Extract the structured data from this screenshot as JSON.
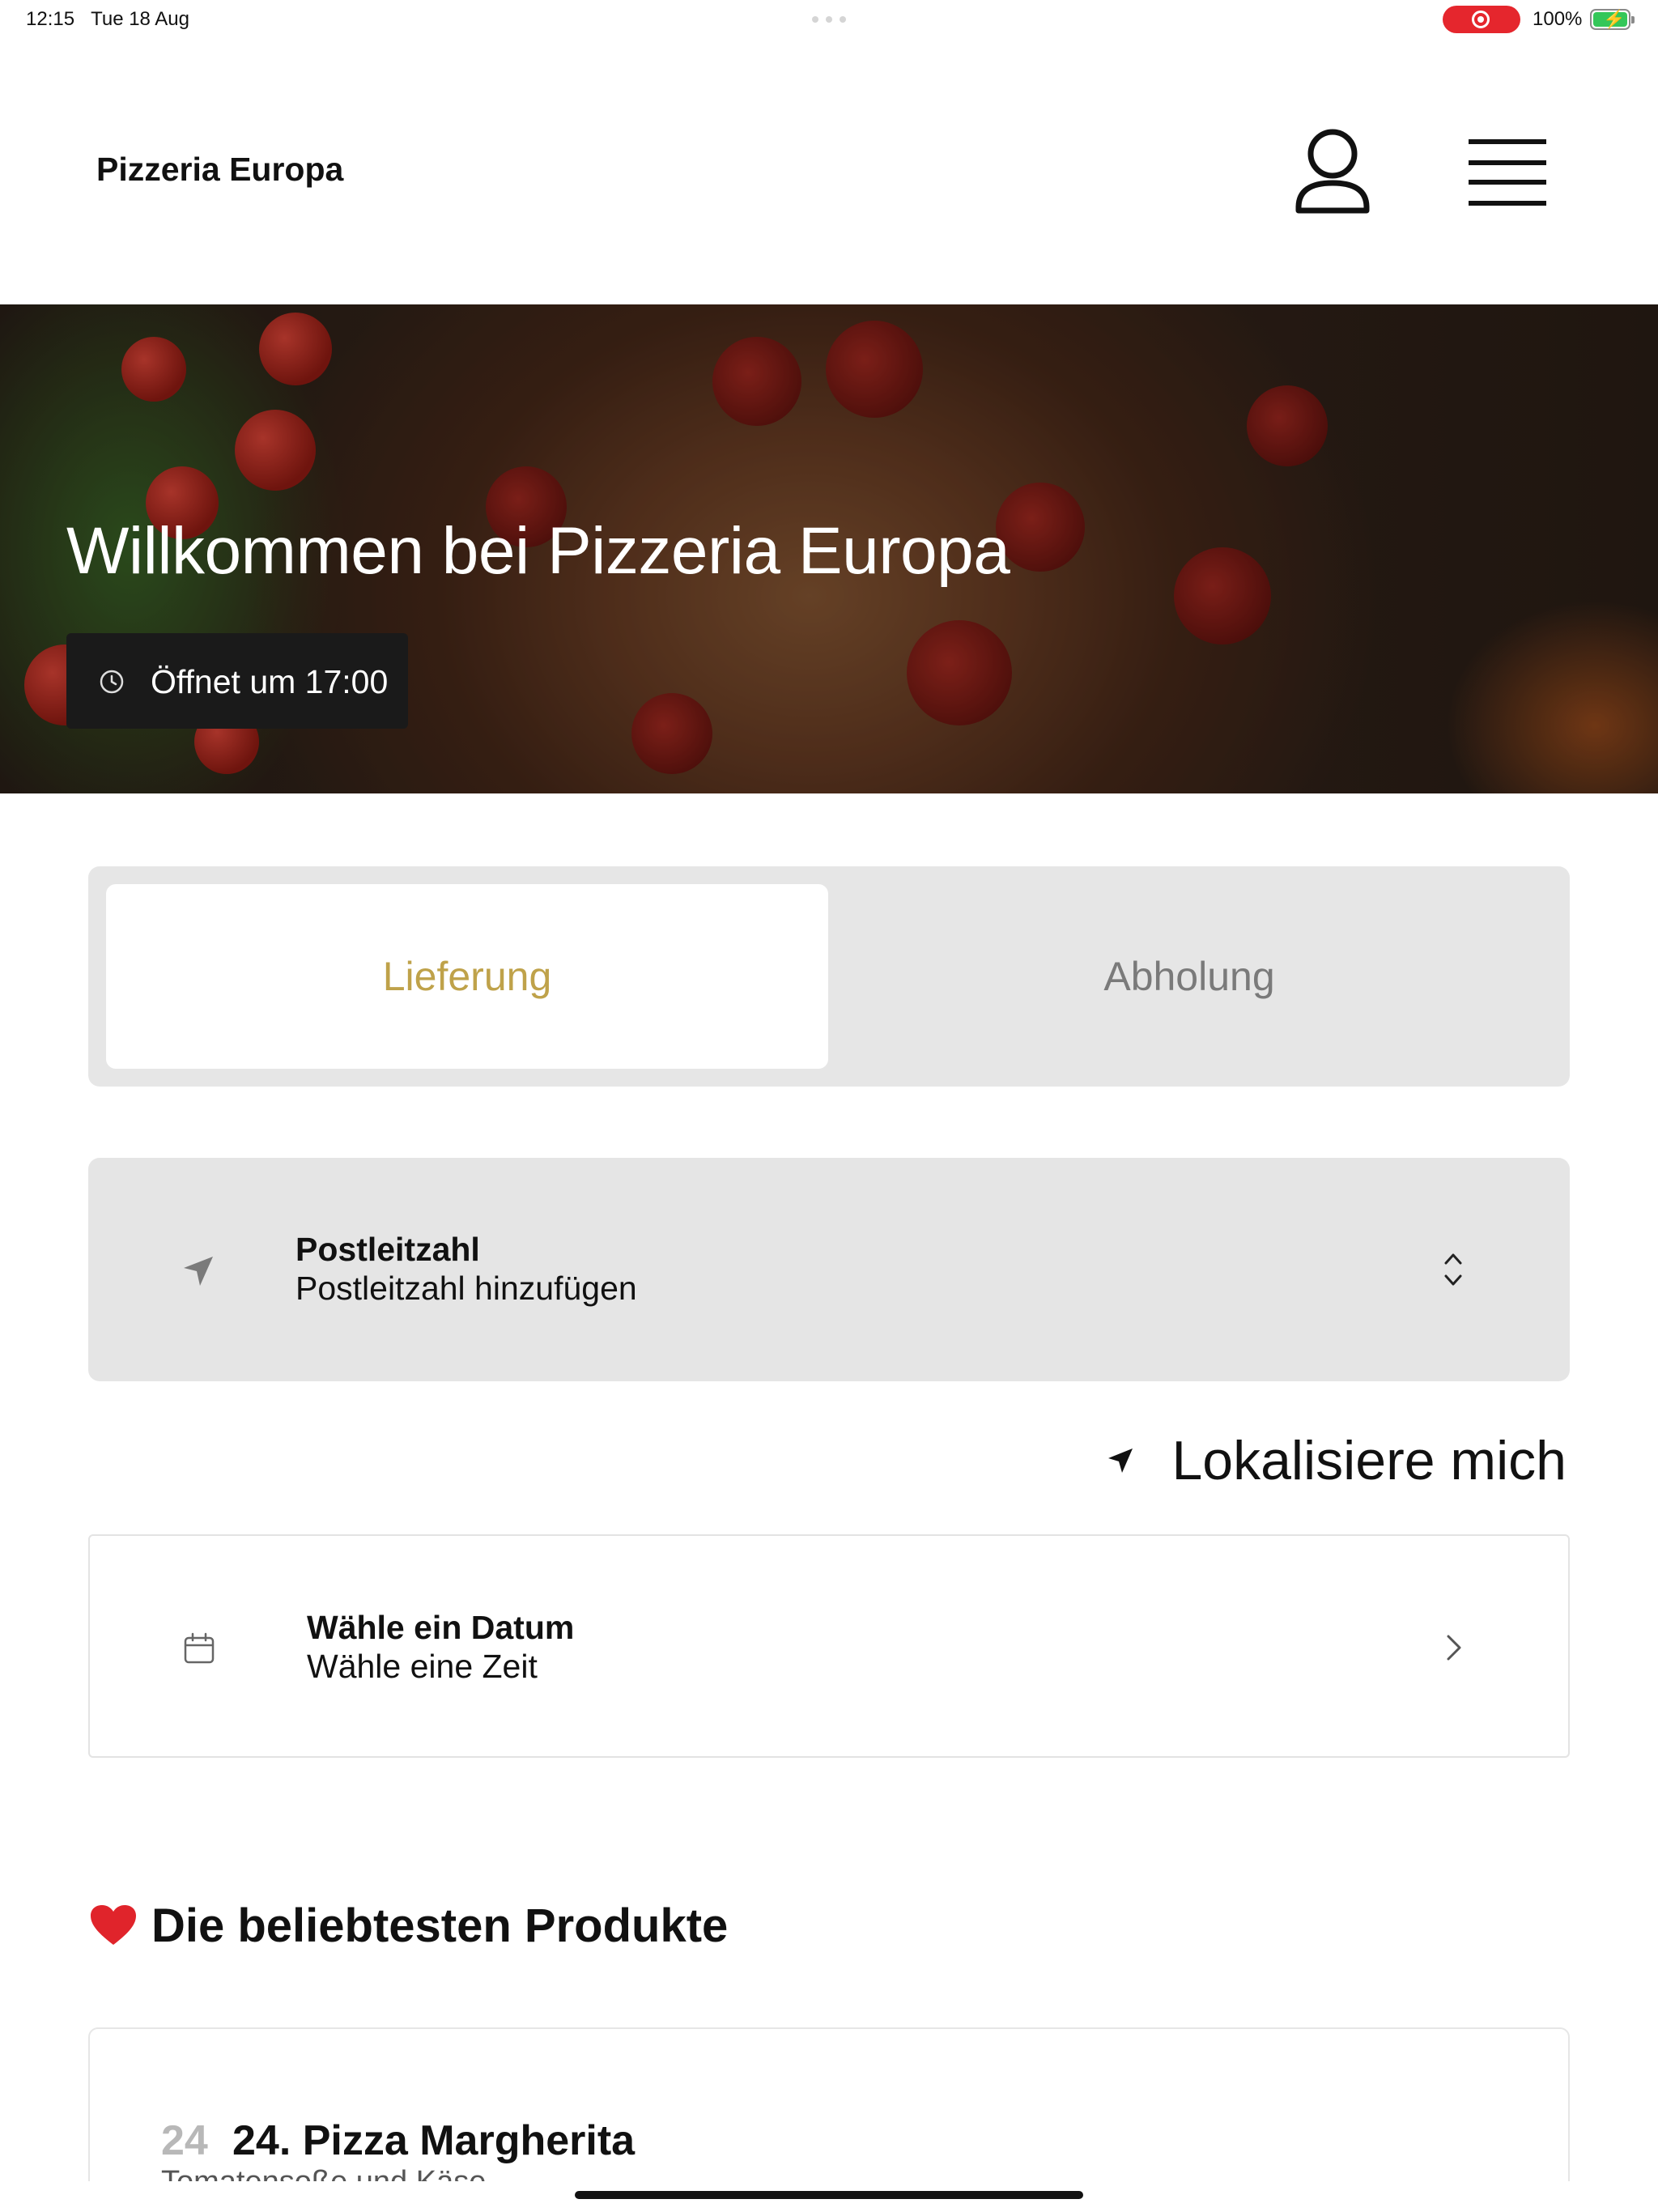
{
  "status_bar": {
    "time": "12:15",
    "date": "Tue 18 Aug",
    "battery": "100%",
    "recording_color": "#e5262d",
    "battery_color": "#34c759"
  },
  "header": {
    "brand": "Pizzeria Europa",
    "icons": [
      "user-icon",
      "menu-icon"
    ]
  },
  "hero": {
    "title": "Willkommen bei Pizzeria Europa",
    "hours": "Öffnet um 17:00"
  },
  "order_mode": {
    "options": [
      "Lieferung",
      "Abholung"
    ],
    "selected": "Lieferung",
    "accent_color": "#bfa24a"
  },
  "postal": {
    "label": "Postleitzahl",
    "value": "Postleitzahl hinzufügen"
  },
  "locate": {
    "label": "Lokalisiere mich"
  },
  "schedule": {
    "date_label": "Wähle ein Datum",
    "time_label": "Wähle eine Zeit"
  },
  "popular": {
    "emoji": "❤️",
    "heading": "Die beliebtesten Produkte",
    "products": [
      {
        "number": "24",
        "name": "24. Pizza Margherita",
        "description": "Tomatensoße und Käse"
      }
    ]
  }
}
